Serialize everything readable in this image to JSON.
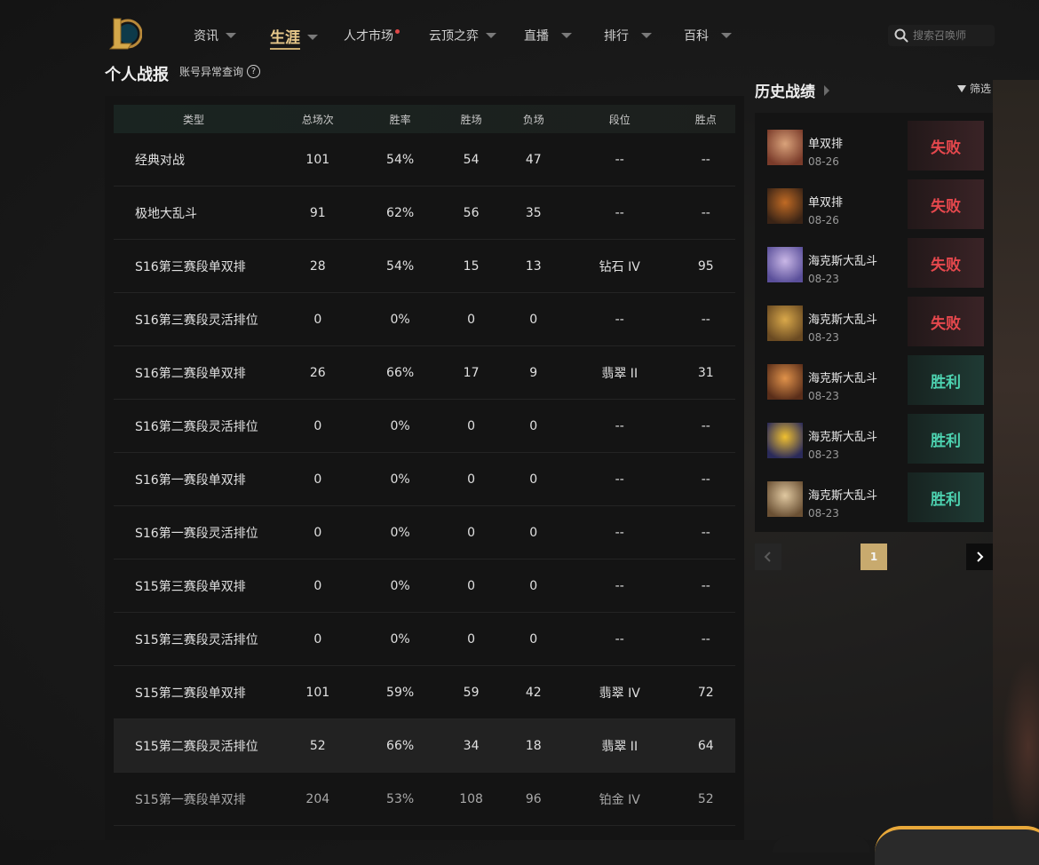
{
  "nav": {
    "items": [
      {
        "label": "资讯"
      },
      {
        "label": "生涯"
      },
      {
        "label": "人才市场"
      },
      {
        "label": "云顶之弈"
      },
      {
        "label": "直播"
      },
      {
        "label": "排行"
      },
      {
        "label": "百科"
      }
    ],
    "search_placeholder": "搜索召唤师"
  },
  "stats": {
    "title": "个人战报",
    "anomaly_link": "账号异常查询",
    "anomaly_icon": "?",
    "columns": [
      "类型",
      "总场次",
      "胜率",
      "胜场",
      "负场",
      "段位",
      "胜点"
    ],
    "rows": [
      [
        "经典对战",
        "101",
        "54%",
        "54",
        "47",
        "--",
        "--"
      ],
      [
        "极地大乱斗",
        "91",
        "62%",
        "56",
        "35",
        "--",
        "--"
      ],
      [
        "S16第三赛段单双排",
        "28",
        "54%",
        "15",
        "13",
        "钻石 IV",
        "95"
      ],
      [
        "S16第三赛段灵活排位",
        "0",
        "0%",
        "0",
        "0",
        "--",
        "--"
      ],
      [
        "S16第二赛段单双排",
        "26",
        "66%",
        "17",
        "9",
        "翡翠 II",
        "31"
      ],
      [
        "S16第二赛段灵活排位",
        "0",
        "0%",
        "0",
        "0",
        "--",
        "--"
      ],
      [
        "S16第一赛段单双排",
        "0",
        "0%",
        "0",
        "0",
        "--",
        "--"
      ],
      [
        "S16第一赛段灵活排位",
        "0",
        "0%",
        "0",
        "0",
        "--",
        "--"
      ],
      [
        "S15第三赛段单双排",
        "0",
        "0%",
        "0",
        "0",
        "--",
        "--"
      ],
      [
        "S15第三赛段灵活排位",
        "0",
        "0%",
        "0",
        "0",
        "--",
        "--"
      ],
      [
        "S15第二赛段单双排",
        "101",
        "59%",
        "59",
        "42",
        "翡翠 IV",
        "72"
      ],
      [
        "S15第二赛段灵活排位",
        "52",
        "66%",
        "34",
        "18",
        "翡翠 II",
        "64"
      ],
      [
        "S15第一赛段单双排",
        "204",
        "53%",
        "108",
        "96",
        "铂金 IV",
        "52"
      ]
    ]
  },
  "history": {
    "title": "历史战绩",
    "filter_label": "筛选",
    "matches": [
      {
        "mode": "单双排",
        "date": "08-26",
        "result": "失败",
        "outcome": "lose",
        "avatar_colors": [
          "#d9a27a",
          "#7a3b2a"
        ]
      },
      {
        "mode": "单双排",
        "date": "08-26",
        "result": "失败",
        "outcome": "lose",
        "avatar_colors": [
          "#c06a24",
          "#3a2416"
        ]
      },
      {
        "mode": "海克斯大乱斗",
        "date": "08-23",
        "result": "失败",
        "outcome": "lose",
        "avatar_colors": [
          "#c9b7e6",
          "#5a4f9a"
        ]
      },
      {
        "mode": "海克斯大乱斗",
        "date": "08-23",
        "result": "失败",
        "outcome": "lose",
        "avatar_colors": [
          "#d9a84a",
          "#6a4a22"
        ]
      },
      {
        "mode": "海克斯大乱斗",
        "date": "08-23",
        "result": "胜利",
        "outcome": "win",
        "avatar_colors": [
          "#e0924a",
          "#5a2e1a"
        ]
      },
      {
        "mode": "海克斯大乱斗",
        "date": "08-23",
        "result": "胜利",
        "outcome": "win",
        "avatar_colors": [
          "#f0c030",
          "#2a2a5a"
        ]
      },
      {
        "mode": "海克斯大乱斗",
        "date": "08-23",
        "result": "胜利",
        "outcome": "win",
        "avatar_colors": [
          "#e0c8a0",
          "#6a5034"
        ]
      }
    ],
    "page": "1"
  },
  "colors": {
    "accent_gold": "#c8aa6e",
    "lose": "#e5484d",
    "win": "#4dd2b0"
  }
}
